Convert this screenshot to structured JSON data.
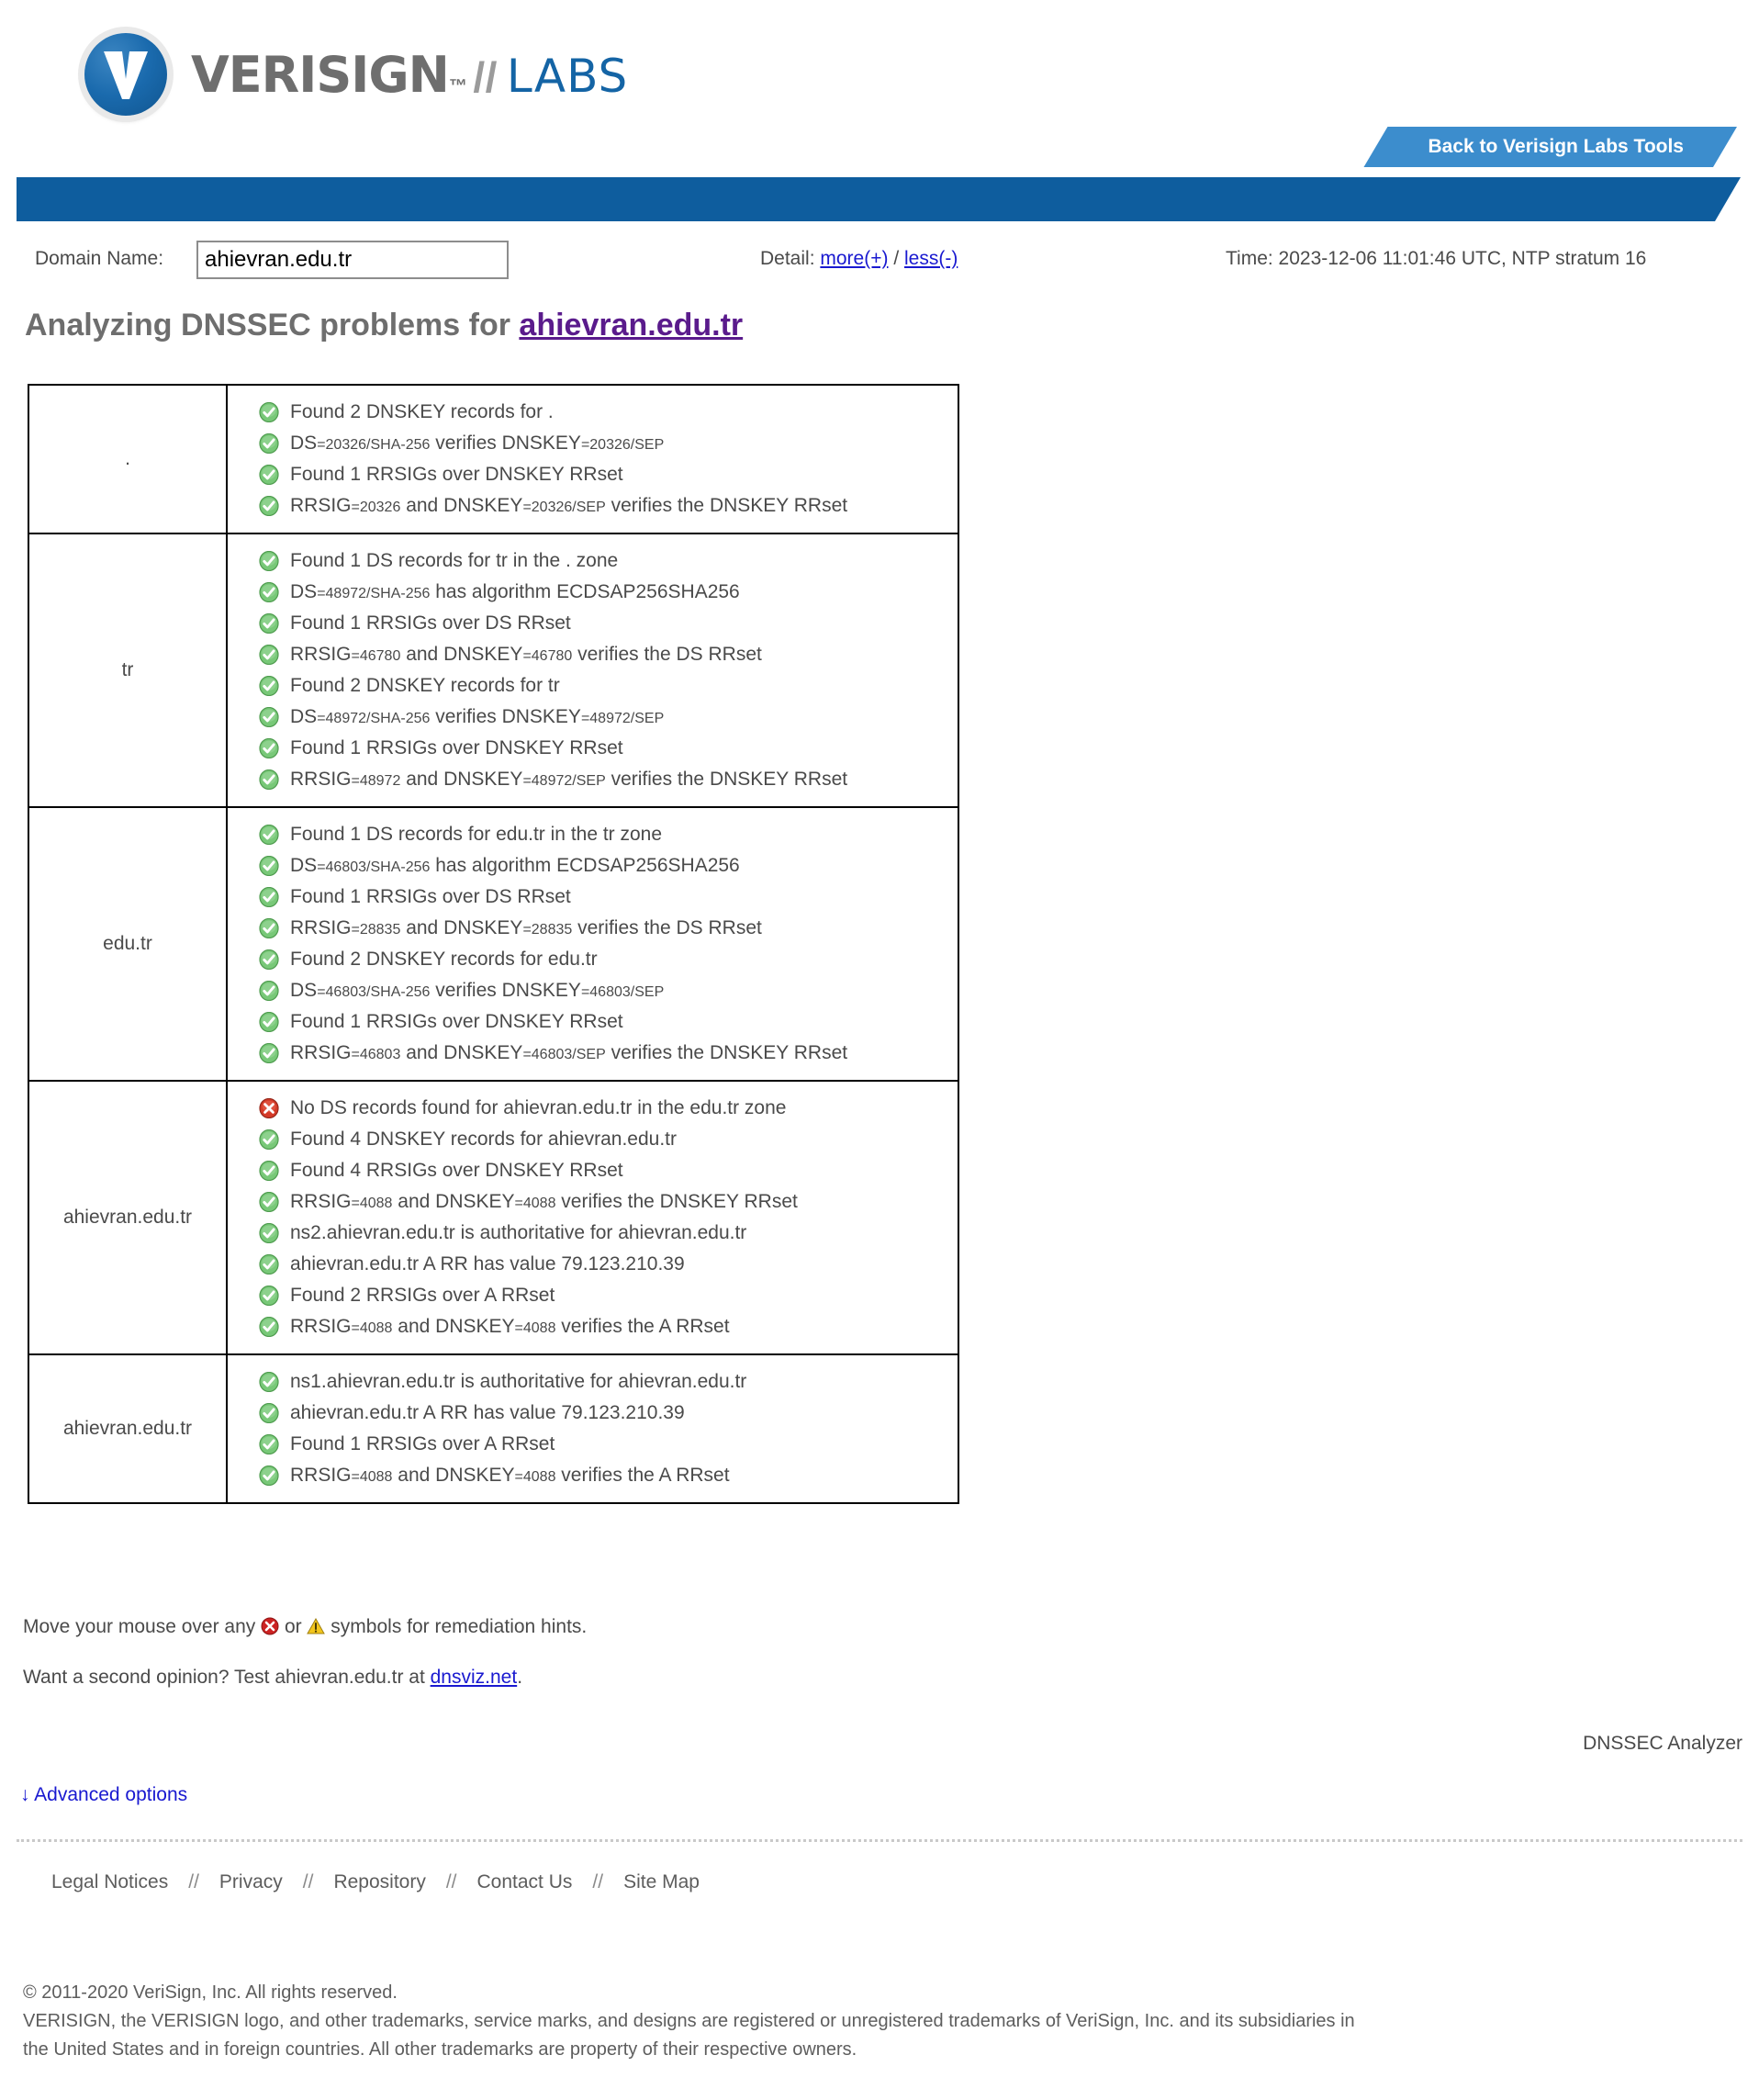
{
  "brand": {
    "verisign": "VERISIGN",
    "trademark": "™",
    "slash": "//",
    "labs": "LABS"
  },
  "header": {
    "back_to_tools": "Back to Verisign Labs Tools"
  },
  "form": {
    "domain_label": "Domain Name:",
    "domain_value": "ahievran.edu.tr",
    "domain_placeholder": "",
    "detail_label": "Detail:",
    "detail_more": "more(+)",
    "detail_separator": "/",
    "detail_less": "less(-)",
    "time": "Time: 2023-12-06 11:01:46 UTC, NTP stratum 16"
  },
  "title": {
    "prefix": "Analyzing DNSSEC problems for ",
    "domain": "ahievran.edu.tr"
  },
  "results": [
    {
      "zone": ".",
      "checks": [
        {
          "status": "ok",
          "parts": [
            {
              "t": "Found 2 DNSKEY records for .",
              "s": false
            }
          ]
        },
        {
          "status": "ok",
          "parts": [
            {
              "t": "DS",
              "s": false
            },
            {
              "t": "=20326/SHA-256",
              "s": true
            },
            {
              "t": " verifies DNSKEY",
              "s": false
            },
            {
              "t": "=20326/SEP",
              "s": true
            }
          ]
        },
        {
          "status": "ok",
          "parts": [
            {
              "t": "Found 1 RRSIGs over DNSKEY RRset",
              "s": false
            }
          ]
        },
        {
          "status": "ok",
          "parts": [
            {
              "t": "RRSIG",
              "s": false
            },
            {
              "t": "=20326",
              "s": true
            },
            {
              "t": " and DNSKEY",
              "s": false
            },
            {
              "t": "=20326/SEP",
              "s": true
            },
            {
              "t": " verifies the DNSKEY RRset",
              "s": false
            }
          ]
        }
      ]
    },
    {
      "zone": "tr",
      "checks": [
        {
          "status": "ok",
          "parts": [
            {
              "t": "Found 1 DS records for tr in the . zone",
              "s": false
            }
          ]
        },
        {
          "status": "ok",
          "parts": [
            {
              "t": "DS",
              "s": false
            },
            {
              "t": "=48972/SHA-256",
              "s": true
            },
            {
              "t": " has algorithm ECDSAP256SHA256",
              "s": false
            }
          ]
        },
        {
          "status": "ok",
          "parts": [
            {
              "t": "Found 1 RRSIGs over DS RRset",
              "s": false
            }
          ]
        },
        {
          "status": "ok",
          "parts": [
            {
              "t": "RRSIG",
              "s": false
            },
            {
              "t": "=46780",
              "s": true
            },
            {
              "t": " and DNSKEY",
              "s": false
            },
            {
              "t": "=46780",
              "s": true
            },
            {
              "t": " verifies the DS RRset",
              "s": false
            }
          ]
        },
        {
          "status": "ok",
          "parts": [
            {
              "t": "Found 2 DNSKEY records for tr",
              "s": false
            }
          ]
        },
        {
          "status": "ok",
          "parts": [
            {
              "t": "DS",
              "s": false
            },
            {
              "t": "=48972/SHA-256",
              "s": true
            },
            {
              "t": " verifies DNSKEY",
              "s": false
            },
            {
              "t": "=48972/SEP",
              "s": true
            }
          ]
        },
        {
          "status": "ok",
          "parts": [
            {
              "t": "Found 1 RRSIGs over DNSKEY RRset",
              "s": false
            }
          ]
        },
        {
          "status": "ok",
          "parts": [
            {
              "t": "RRSIG",
              "s": false
            },
            {
              "t": "=48972",
              "s": true
            },
            {
              "t": " and DNSKEY",
              "s": false
            },
            {
              "t": "=48972/SEP",
              "s": true
            },
            {
              "t": " verifies the DNSKEY RRset",
              "s": false
            }
          ]
        }
      ]
    },
    {
      "zone": "edu.tr",
      "checks": [
        {
          "status": "ok",
          "parts": [
            {
              "t": "Found 1 DS records for edu.tr in the tr zone",
              "s": false
            }
          ]
        },
        {
          "status": "ok",
          "parts": [
            {
              "t": "DS",
              "s": false
            },
            {
              "t": "=46803/SHA-256",
              "s": true
            },
            {
              "t": " has algorithm ECDSAP256SHA256",
              "s": false
            }
          ]
        },
        {
          "status": "ok",
          "parts": [
            {
              "t": "Found 1 RRSIGs over DS RRset",
              "s": false
            }
          ]
        },
        {
          "status": "ok",
          "parts": [
            {
              "t": "RRSIG",
              "s": false
            },
            {
              "t": "=28835",
              "s": true
            },
            {
              "t": " and DNSKEY",
              "s": false
            },
            {
              "t": "=28835",
              "s": true
            },
            {
              "t": " verifies the DS RRset",
              "s": false
            }
          ]
        },
        {
          "status": "ok",
          "parts": [
            {
              "t": "Found 2 DNSKEY records for edu.tr",
              "s": false
            }
          ]
        },
        {
          "status": "ok",
          "parts": [
            {
              "t": "DS",
              "s": false
            },
            {
              "t": "=46803/SHA-256",
              "s": true
            },
            {
              "t": " verifies DNSKEY",
              "s": false
            },
            {
              "t": "=46803/SEP",
              "s": true
            }
          ]
        },
        {
          "status": "ok",
          "parts": [
            {
              "t": "Found 1 RRSIGs over DNSKEY RRset",
              "s": false
            }
          ]
        },
        {
          "status": "ok",
          "parts": [
            {
              "t": "RRSIG",
              "s": false
            },
            {
              "t": "=46803",
              "s": true
            },
            {
              "t": " and DNSKEY",
              "s": false
            },
            {
              "t": "=46803/SEP",
              "s": true
            },
            {
              "t": " verifies the DNSKEY RRset",
              "s": false
            }
          ]
        }
      ]
    },
    {
      "zone": "ahievran.edu.tr",
      "checks": [
        {
          "status": "error",
          "parts": [
            {
              "t": "No DS records found for ahievran.edu.tr in the edu.tr zone",
              "s": false
            }
          ]
        },
        {
          "status": "ok",
          "parts": [
            {
              "t": "Found 4 DNSKEY records for ahievran.edu.tr",
              "s": false
            }
          ]
        },
        {
          "status": "ok",
          "parts": [
            {
              "t": "Found 4 RRSIGs over DNSKEY RRset",
              "s": false
            }
          ]
        },
        {
          "status": "ok",
          "parts": [
            {
              "t": "RRSIG",
              "s": false
            },
            {
              "t": "=4088",
              "s": true
            },
            {
              "t": " and DNSKEY",
              "s": false
            },
            {
              "t": "=4088",
              "s": true
            },
            {
              "t": " verifies the DNSKEY RRset",
              "s": false
            }
          ]
        },
        {
          "status": "ok",
          "parts": [
            {
              "t": "ns2.ahievran.edu.tr is authoritative for ahievran.edu.tr",
              "s": false
            }
          ]
        },
        {
          "status": "ok",
          "parts": [
            {
              "t": "ahievran.edu.tr A RR has value 79.123.210.39",
              "s": false
            }
          ]
        },
        {
          "status": "ok",
          "parts": [
            {
              "t": "Found 2 RRSIGs over A RRset",
              "s": false
            }
          ]
        },
        {
          "status": "ok",
          "parts": [
            {
              "t": "RRSIG",
              "s": false
            },
            {
              "t": "=4088",
              "s": true
            },
            {
              "t": " and DNSKEY",
              "s": false
            },
            {
              "t": "=4088",
              "s": true
            },
            {
              "t": " verifies the A RRset",
              "s": false
            }
          ]
        }
      ]
    },
    {
      "zone": "ahievran.edu.tr",
      "checks": [
        {
          "status": "ok",
          "parts": [
            {
              "t": "ns1.ahievran.edu.tr is authoritative for ahievran.edu.tr",
              "s": false
            }
          ]
        },
        {
          "status": "ok",
          "parts": [
            {
              "t": "ahievran.edu.tr A RR has value 79.123.210.39",
              "s": false
            }
          ]
        },
        {
          "status": "ok",
          "parts": [
            {
              "t": "Found 1 RRSIGs over A RRset",
              "s": false
            }
          ]
        },
        {
          "status": "ok",
          "parts": [
            {
              "t": "RRSIG",
              "s": false
            },
            {
              "t": "=4088",
              "s": true
            },
            {
              "t": " and DNSKEY",
              "s": false
            },
            {
              "t": "=4088",
              "s": true
            },
            {
              "t": " verifies the A RRset",
              "s": false
            }
          ]
        }
      ]
    }
  ],
  "notes": {
    "hint_prefix": "Move your mouse over any ",
    "hint_middle": " or ",
    "hint_suffix": " symbols for remediation hints.",
    "second_prefix": "Want a second opinion? Test ahievran.edu.tr at ",
    "second_link": "dnsviz.net",
    "second_suffix": "."
  },
  "analyzer_tag": "DNSSEC Analyzer",
  "advanced_options": "↓ Advanced options",
  "footer": {
    "links": [
      "Legal Notices",
      "Privacy",
      "Repository",
      "Contact Us",
      "Site Map"
    ],
    "separator": "//",
    "copyright_line1": "© 2011-2020 VeriSign, Inc. All rights reserved.",
    "copyright_line2": "VERISIGN, the VERISIGN logo, and other trademarks, service marks, and designs are registered or unregistered trademarks of VeriSign, Inc. and its subsidiaries in",
    "copyright_line3": "the United States and in foreign countries. All other trademarks are property of their respective owners."
  },
  "colors": {
    "brand_blue": "#1464a5",
    "band_blue": "#0e5d9e",
    "tab_blue": "#3c8dcd",
    "ok_green": "#5cb85c",
    "error_red": "#cc2222",
    "warn_yellow": "#f2c51c",
    "link_blue": "#1919d0",
    "title_purple": "#5a1b8c"
  }
}
